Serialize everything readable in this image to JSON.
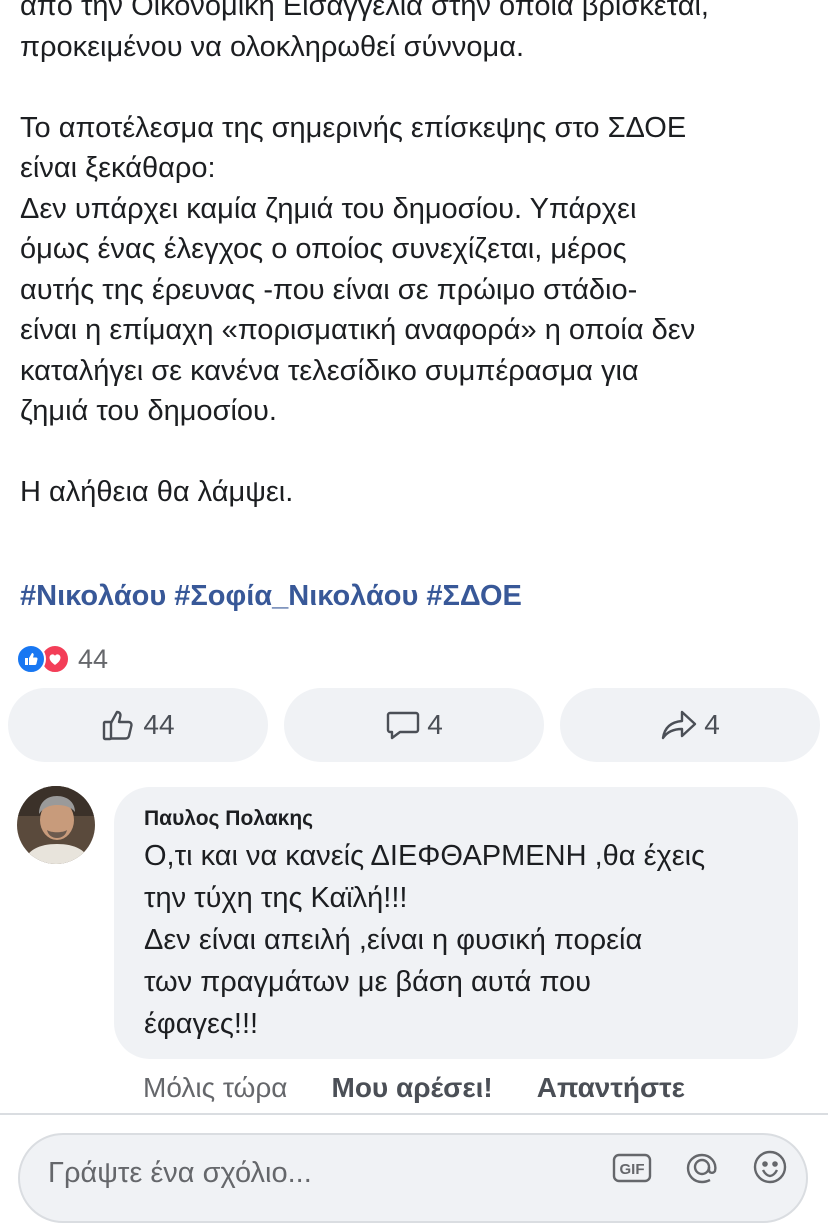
{
  "post": {
    "lines_a": [
      "από την Οικονομική Εισαγγελία στην οποία βρίσκεται,",
      "προκειμένου να ολοκληρωθεί σύννομα."
    ],
    "lines_b": [
      "Το αποτέλεσμα της σημερινής επίσκεψης στο ΣΔΟΕ",
      "είναι ξεκάθαρο:",
      "Δεν υπάρχει καμία ζημιά του δημοσίου. Υπάρχει",
      "όμως ένας έλεγχος ο οποίος συνεχίζεται, μέρος",
      "αυτής της έρευνας -που είναι σε πρώιμο στάδιο-",
      "είναι η επίμαχη «πορισματική αναφορά» η οποία δεν",
      "καταλήγει σε κανένα τελεσίδικο συμπέρασμα για",
      "ζημιά του δημοσίου."
    ],
    "closing": "Η αλήθεια θα λάμψει.",
    "hashtags": [
      "#Νικολάου",
      "#Σοφία_Νικολάου",
      "#ΣΔΟΕ"
    ]
  },
  "reactions": {
    "icons": [
      "like-reaction",
      "love-reaction"
    ],
    "count": "44"
  },
  "actions": {
    "like_count": "44",
    "comment_count": "4",
    "share_count": "4"
  },
  "comment": {
    "author": "Παυλος Πολακης",
    "lines": [
      "Ο,τι και να κανείς ΔΙΕΦΘΑΡΜΕΝΗ ,θα έχεις",
      "την τύχη της Καϊλή!!!",
      "Δεν είναι απειλή ,είναι η φυσική πορεία",
      "των πραγμάτων με βάση αυτά που",
      "έφαγες!!!"
    ],
    "time": "Μόλις τώρα",
    "like_label": "Μου αρέσει!",
    "reply_label": "Απαντήστε"
  },
  "composer": {
    "placeholder": "Γράψτε ένα σχόλιο...",
    "gif_label": "GIF",
    "tools": [
      "gif-icon",
      "mention-icon",
      "emoji-icon"
    ]
  },
  "colors": {
    "hashtag": "#385898",
    "like_blue": "#1877f2",
    "love_red": "#f33e58",
    "bubble_bg": "#f0f2f5",
    "muted": "#65676b"
  }
}
